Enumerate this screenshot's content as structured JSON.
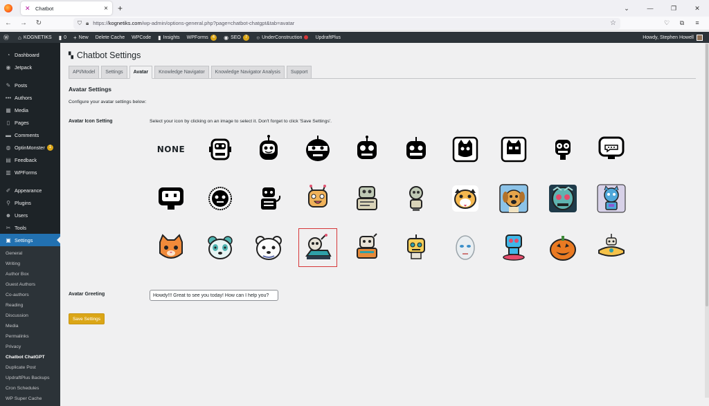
{
  "browser": {
    "tab_title": "Chatbot",
    "url_prefix": "https://",
    "url_domain": "kognetiks.com",
    "url_path": "/wp-admin/options-general.php?page=chatbot-chatgpt&tab=avatar"
  },
  "adminbar": {
    "site": "KOGNETIKS",
    "comments_count": "0",
    "new": "New",
    "delete_cache": "Delete Cache",
    "wpcode": "WPCode",
    "insights": "Insights",
    "wpforms": "WPForms",
    "wpforms_badge": "4",
    "seo": "SEO",
    "seo_badge": "7",
    "under_construction": "UnderConstruction",
    "updraft": "UpdraftPlus",
    "howdy": "Howdy, Stephen Howell"
  },
  "sidebar": {
    "items": [
      {
        "label": "Dashboard",
        "icon": "dashboard-icon"
      },
      {
        "label": "Jetpack",
        "icon": "jetpack-icon"
      },
      {
        "label": "Posts",
        "icon": "pin-icon"
      },
      {
        "label": "Authors",
        "icon": "dots-icon"
      },
      {
        "label": "Media",
        "icon": "media-icon"
      },
      {
        "label": "Pages",
        "icon": "page-icon"
      },
      {
        "label": "Comments",
        "icon": "comment-icon"
      },
      {
        "label": "OptinMonster",
        "icon": "optin-icon",
        "badge": "1"
      },
      {
        "label": "Feedback",
        "icon": "feedback-icon"
      },
      {
        "label": "WPForms",
        "icon": "forms-icon"
      },
      {
        "label": "Appearance",
        "icon": "brush-icon"
      },
      {
        "label": "Plugins",
        "icon": "plugin-icon"
      },
      {
        "label": "Users",
        "icon": "user-icon"
      },
      {
        "label": "Tools",
        "icon": "wrench-icon"
      },
      {
        "label": "Settings",
        "icon": "settings-icon"
      }
    ],
    "settings_sub": [
      "General",
      "Writing",
      "Author Box",
      "Guest Authors",
      "Co-authors",
      "Reading",
      "Discussion",
      "Media",
      "Permalinks",
      "Privacy",
      "Chatbot ChatGPT",
      "Duplicate Post",
      "UpdraftPlus Backups",
      "Cron Schedules",
      "WP Super Cache"
    ]
  },
  "page": {
    "title": "Chatbot Settings",
    "tabs": [
      "API/Model",
      "Settings",
      "Avatar",
      "Knowledge Navigator",
      "Knowledge Navigator Analysis",
      "Support"
    ],
    "section_title": "Avatar Settings",
    "section_desc": "Configure your avatar settings below:",
    "icon_label": "Avatar Icon Setting",
    "icon_help": "Select your icon by clicking on an image to select it. Don't forget to click 'Save Settings'.",
    "none_label": "NONE",
    "greeting_label": "Avatar Greeting",
    "greeting_value": "Howdy!!! Great to see you today! How can I help you?",
    "save_label": "Save Settings"
  },
  "colors": {
    "accent": "#2271b1",
    "save": "#dba617",
    "selected": "#d63638"
  }
}
